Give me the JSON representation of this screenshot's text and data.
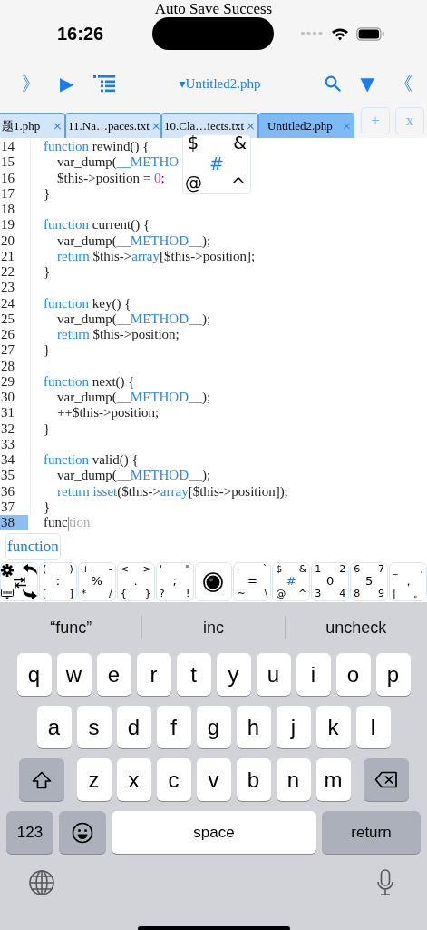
{
  "toast": "Auto Save Success",
  "status_bar": {
    "time": "16:26"
  },
  "toolbar": {
    "left": [
      {
        "kind": "text",
        "text": "》"
      },
      {
        "kind": "text",
        "text": "▶"
      },
      {
        "kind": "list"
      }
    ],
    "title_caret": "▾",
    "title": "Untitled2.php",
    "right": [
      {
        "kind": "search"
      },
      {
        "kind": "text",
        "text": "▼"
      },
      {
        "kind": "text",
        "text": "《"
      }
    ]
  },
  "tabs": [
    {
      "label": "题1.php",
      "close": "×",
      "selected": false
    },
    {
      "label": "11.Na…paces.txt",
      "close": "×",
      "selected": false
    },
    {
      "label": "10.Cla…iects.txt",
      "close": "×",
      "selected": false
    },
    {
      "label": "Untitled2.php",
      "close": "×",
      "selected": true
    }
  ],
  "tab_buttons": [
    "+",
    "x"
  ],
  "key_preview": {
    "tl": "$",
    "tr": "&",
    "c": "#",
    "bl": "@",
    "br": "^"
  },
  "code": [
    {
      "number": "14",
      "current": false,
      "tokens": [
        {
          "text": "    function",
          "kind": "kw"
        },
        {
          "text": " rewind() {",
          "kind": "plain"
        }
      ]
    },
    {
      "number": "15",
      "current": false,
      "tokens": [
        {
          "text": "        var_dump(",
          "kind": "plain"
        },
        {
          "text": "__METHO",
          "kind": "kw"
        }
      ]
    },
    {
      "number": "16",
      "current": false,
      "tokens": [
        {
          "text": "        $this->position = ",
          "kind": "plain"
        },
        {
          "text": "0",
          "kind": "num"
        },
        {
          "text": ";",
          "kind": "plain"
        }
      ]
    },
    {
      "number": "17",
      "current": false,
      "tokens": [
        {
          "text": "    }",
          "kind": "plain"
        }
      ]
    },
    {
      "number": "18",
      "current": false
    },
    {
      "number": "19",
      "current": false,
      "tokens": [
        {
          "text": "    function",
          "kind": "kw"
        },
        {
          "text": " current() {",
          "kind": "plain"
        }
      ]
    },
    {
      "number": "20",
      "current": false,
      "tokens": [
        {
          "text": "        var_dump(",
          "kind": "plain"
        },
        {
          "text": "__METHOD__",
          "kind": "kw"
        },
        {
          "text": ");",
          "kind": "plain"
        }
      ]
    },
    {
      "number": "21",
      "current": false,
      "tokens": [
        {
          "text": "        return",
          "kind": "kw"
        },
        {
          "text": " $this->",
          "kind": "plain"
        },
        {
          "text": "array",
          "kind": "kw"
        },
        {
          "text": "[$this->position];",
          "kind": "plain"
        }
      ]
    },
    {
      "number": "22",
      "current": false,
      "tokens": [
        {
          "text": "    }",
          "kind": "plain"
        }
      ]
    },
    {
      "number": "23",
      "current": false
    },
    {
      "number": "24",
      "current": false,
      "tokens": [
        {
          "text": "    function",
          "kind": "kw"
        },
        {
          "text": " key() {",
          "kind": "plain"
        }
      ]
    },
    {
      "number": "25",
      "current": false,
      "tokens": [
        {
          "text": "        var_dump(",
          "kind": "plain"
        },
        {
          "text": "__METHOD__",
          "kind": "kw"
        },
        {
          "text": ");",
          "kind": "plain"
        }
      ]
    },
    {
      "number": "26",
      "current": false,
      "tokens": [
        {
          "text": "        return",
          "kind": "kw"
        },
        {
          "text": " $this->position;",
          "kind": "plain"
        }
      ]
    },
    {
      "number": "27",
      "current": false,
      "tokens": [
        {
          "text": "    }",
          "kind": "plain"
        }
      ]
    },
    {
      "number": "28",
      "current": false
    },
    {
      "number": "29",
      "current": false,
      "tokens": [
        {
          "text": "    function",
          "kind": "kw"
        },
        {
          "text": " next() {",
          "kind": "plain"
        }
      ]
    },
    {
      "number": "30",
      "current": false,
      "tokens": [
        {
          "text": "        var_dump(",
          "kind": "plain"
        },
        {
          "text": "__METHOD__",
          "kind": "kw"
        },
        {
          "text": ");",
          "kind": "plain"
        }
      ]
    },
    {
      "number": "31",
      "current": false,
      "tokens": [
        {
          "text": "        ++$this->position;",
          "kind": "plain"
        }
      ]
    },
    {
      "number": "32",
      "current": false,
      "tokens": [
        {
          "text": "    }",
          "kind": "plain"
        }
      ]
    },
    {
      "number": "33",
      "current": false
    },
    {
      "number": "34",
      "current": false,
      "tokens": [
        {
          "text": "    function",
          "kind": "kw"
        },
        {
          "text": " valid() {",
          "kind": "plain"
        }
      ]
    },
    {
      "number": "35",
      "current": false,
      "tokens": [
        {
          "text": "        var_dump(",
          "kind": "plain"
        },
        {
          "text": "__METHOD__",
          "kind": "kw"
        },
        {
          "text": ");",
          "kind": "plain"
        }
      ]
    },
    {
      "number": "36",
      "current": false,
      "tokens": [
        {
          "text": "        return isset",
          "kind": "kw"
        },
        {
          "text": "($this->",
          "kind": "plain"
        },
        {
          "text": "array",
          "kind": "kw"
        },
        {
          "text": "[$this->position]);",
          "kind": "plain"
        }
      ]
    },
    {
      "number": "37",
      "current": false,
      "tokens": [
        {
          "text": "    }",
          "kind": "plain"
        }
      ]
    },
    {
      "number": "38",
      "current": true,
      "tokens": [
        {
          "text": "    func",
          "kind": "plain"
        },
        {
          "text": "tion",
          "kind": "ghost"
        }
      ]
    }
  ],
  "completion": "function",
  "symbol_keys": [
    {
      "kind": "tools"
    },
    {
      "kind": "chars",
      "tl": "(",
      "tr": ")",
      "c": ":",
      "bl": "[",
      "br": "]",
      "accent": false
    },
    {
      "kind": "chars",
      "tl": "+",
      "tr": "-",
      "c": "%",
      "bl": "*",
      "br": "/",
      "accent": false
    },
    {
      "kind": "chars",
      "tl": "<",
      "tr": ">",
      "c": ".",
      "bl": "{",
      "br": "}",
      "accent": false
    },
    {
      "kind": "chars",
      "tl": "'",
      "tr": "\"",
      "c": ";",
      "bl": "?",
      "br": "!",
      "accent": false
    },
    {
      "kind": "record"
    },
    {
      "kind": "chars",
      "tl": "·",
      "tr": "`",
      "c": "=",
      "bl": "~",
      "br": "\\",
      "accent": false
    },
    {
      "kind": "chars",
      "tl": "$",
      "tr": "&",
      "c": "#",
      "bl": "@",
      "br": "^",
      "accent": true
    },
    {
      "kind": "chars",
      "tl": "1",
      "tr": "2",
      "c": "0",
      "bl": "3",
      "br": "4",
      "accent": false
    },
    {
      "kind": "chars",
      "tl": "6",
      "tr": "7",
      "c": "5",
      "bl": "8",
      "br": "9",
      "accent": false
    },
    {
      "kind": "chars",
      "tl": "_",
      "tr": ",",
      "c": "，",
      "bl": "|",
      "br": "。",
      "accent": false
    }
  ],
  "keyboard": {
    "suggestions": [
      "“func”",
      "inc",
      "uncheck"
    ],
    "letter_rows": [
      [
        {
          "kind": "letter",
          "text": "q"
        },
        {
          "kind": "letter",
          "text": "w"
        },
        {
          "kind": "letter",
          "text": "e"
        },
        {
          "kind": "letter",
          "text": "r"
        },
        {
          "kind": "letter",
          "text": "t"
        },
        {
          "kind": "letter",
          "text": "y"
        },
        {
          "kind": "letter",
          "text": "u"
        },
        {
          "kind": "letter",
          "text": "i"
        },
        {
          "kind": "letter",
          "text": "o"
        },
        {
          "kind": "letter",
          "text": "p"
        }
      ],
      [
        {
          "kind": "letter",
          "text": "a"
        },
        {
          "kind": "letter",
          "text": "s"
        },
        {
          "kind": "letter",
          "text": "d"
        },
        {
          "kind": "letter",
          "text": "f"
        },
        {
          "kind": "letter",
          "text": "g"
        },
        {
          "kind": "letter",
          "text": "h"
        },
        {
          "kind": "letter",
          "text": "j"
        },
        {
          "kind": "letter",
          "text": "k"
        },
        {
          "kind": "letter",
          "text": "l"
        }
      ],
      [
        {
          "kind": "shift"
        },
        {
          "kind": "letter",
          "text": "z"
        },
        {
          "kind": "letter",
          "text": "x"
        },
        {
          "kind": "letter",
          "text": "c"
        },
        {
          "kind": "letter",
          "text": "v"
        },
        {
          "kind": "letter",
          "text": "b"
        },
        {
          "kind": "letter",
          "text": "n"
        },
        {
          "kind": "letter",
          "text": "m"
        },
        {
          "kind": "delete"
        }
      ]
    ],
    "bottom_row": [
      {
        "kind": "mode",
        "text": "123"
      },
      {
        "kind": "emoji"
      },
      {
        "kind": "space",
        "text": "space"
      },
      {
        "kind": "return",
        "text": "return"
      }
    ]
  }
}
